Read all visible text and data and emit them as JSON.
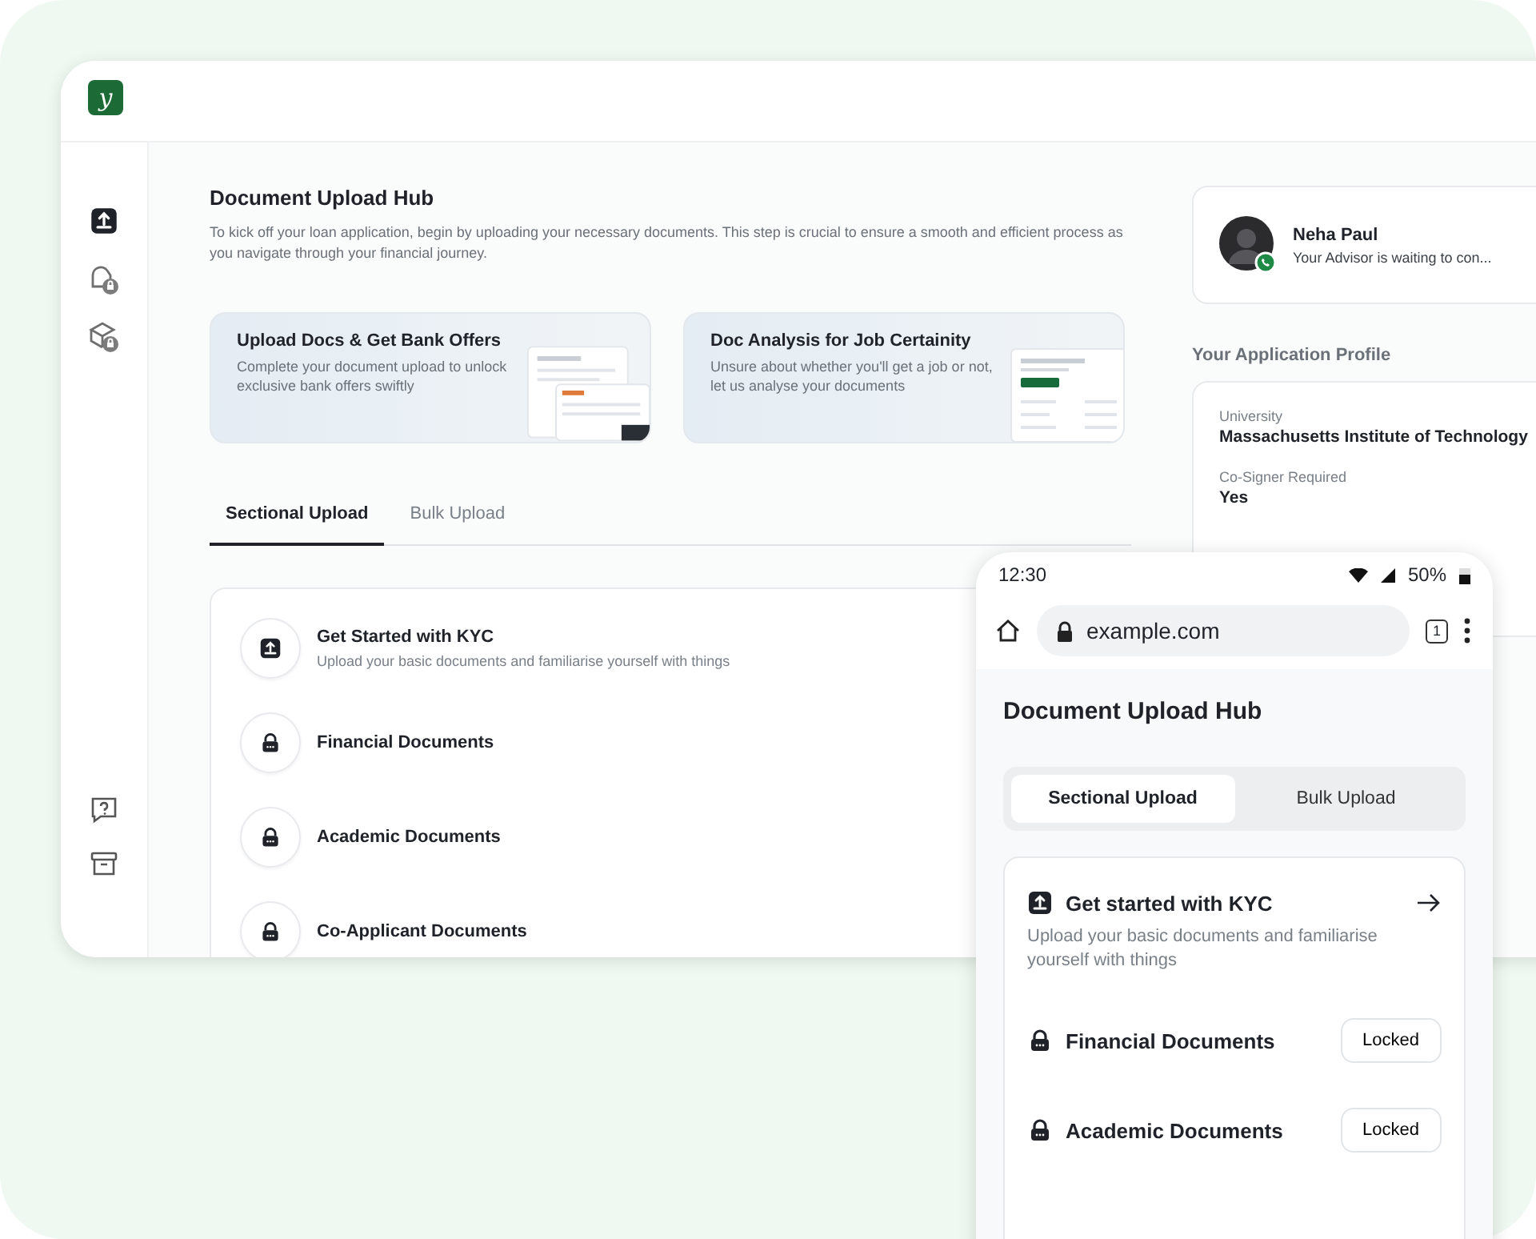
{
  "logo": {
    "text": "y"
  },
  "sidebar": {
    "items": [
      {
        "kind": "upload",
        "selected": true
      },
      {
        "kind": "document-lock",
        "selected": false
      },
      {
        "kind": "box-lock",
        "selected": false
      }
    ],
    "bottom_items": [
      {
        "kind": "help"
      },
      {
        "kind": "archive"
      }
    ]
  },
  "page": {
    "title": "Document Upload Hub",
    "intro": "To kick off your loan application, begin by uploading your necessary documents. This step is crucial to ensure a smooth and efficient process as you navigate through your financial journey."
  },
  "banners": [
    {
      "kind": "offers",
      "title": "Upload Docs & Get Bank Offers",
      "text": "Complete your document upload to unlock exclusive bank offers swiftly"
    },
    {
      "kind": "analysis",
      "title": "Doc Analysis for Job Certainity",
      "text": "Unsure about whether you'll get a job or not, let us analyse your documents"
    }
  ],
  "tabs": [
    {
      "label": "Sectional Upload",
      "selected": true
    },
    {
      "label": "Bulk Upload",
      "selected": false
    }
  ],
  "sections": [
    {
      "kind": "upload",
      "title": "Get Started with KYC",
      "subtitle": "Upload your basic documents and familiarise yourself with things"
    },
    {
      "kind": "locked",
      "title": "Financial Documents"
    },
    {
      "kind": "locked",
      "title": "Academic Documents"
    },
    {
      "kind": "locked",
      "title": "Co-Applicant Documents"
    }
  ],
  "advisor": {
    "name": "Neha Paul",
    "status": "Your Advisor is waiting to con..."
  },
  "profile": {
    "heading": "Your Application Profile",
    "fields": [
      {
        "label": "University",
        "value": "Massachusetts Institute of Technology"
      },
      {
        "label": "Co-Signer Required",
        "value": "Yes"
      }
    ]
  },
  "phone": {
    "time": "12:30",
    "battery": "50%",
    "url": "example.com",
    "tab_count": "1",
    "title": "Document Upload Hub",
    "tabs": [
      {
        "label": "Sectional Upload",
        "selected": true
      },
      {
        "label": "Bulk Upload",
        "selected": false
      }
    ],
    "sections": [
      {
        "kind": "upload",
        "title": "Get started with KYC",
        "subtitle": "Upload your basic documents and familiarise yourself with things"
      },
      {
        "kind": "locked",
        "title": "Financial Documents",
        "status": "Locked"
      },
      {
        "kind": "locked",
        "title": "Academic Documents",
        "status": "Locked"
      }
    ]
  }
}
